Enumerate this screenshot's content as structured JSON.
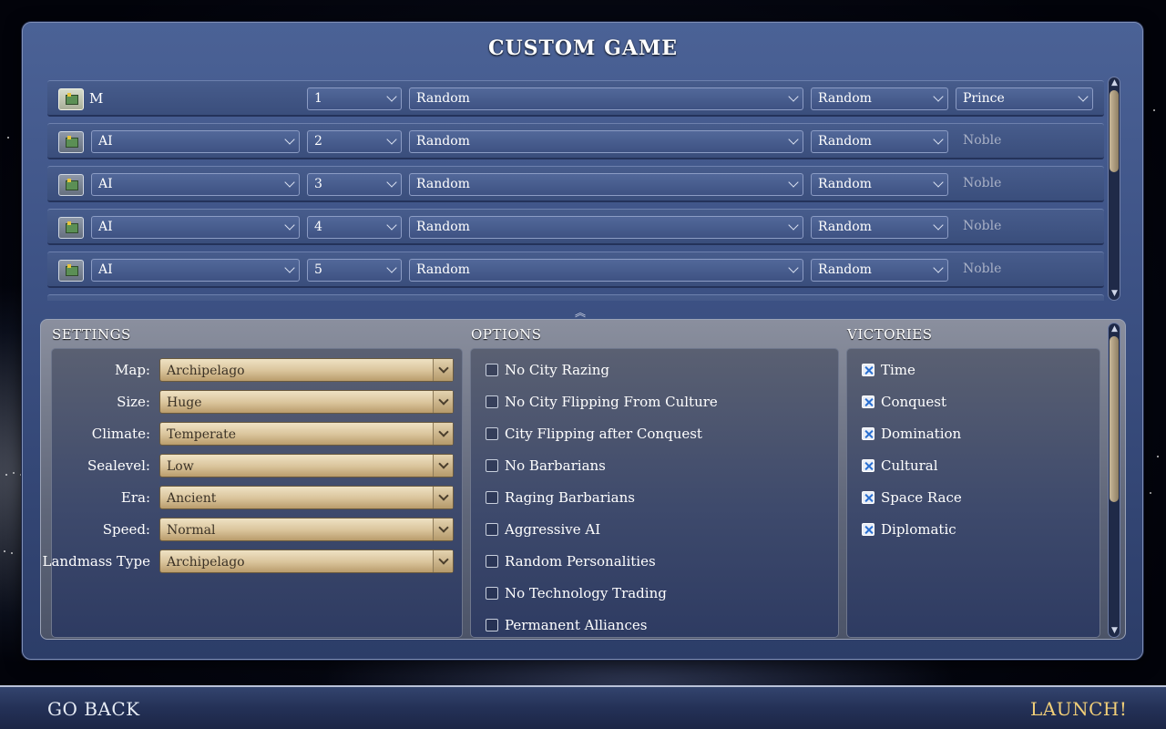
{
  "title": "CUSTOM GAME",
  "players": [
    {
      "type": "M",
      "team": "1",
      "civ": "Random",
      "leader": "Random",
      "level": "Prince",
      "level_is_dropdown": true
    },
    {
      "type": "AI",
      "team": "2",
      "civ": "Random",
      "leader": "Random",
      "level": "Noble"
    },
    {
      "type": "AI",
      "team": "3",
      "civ": "Random",
      "leader": "Random",
      "level": "Noble"
    },
    {
      "type": "AI",
      "team": "4",
      "civ": "Random",
      "leader": "Random",
      "level": "Noble"
    },
    {
      "type": "AI",
      "team": "5",
      "civ": "Random",
      "leader": "Random",
      "level": "Noble"
    }
  ],
  "settings": {
    "heading": "SETTINGS",
    "items": [
      {
        "label": "Map:",
        "value": "Archipelago"
      },
      {
        "label": "Size:",
        "value": "Huge"
      },
      {
        "label": "Climate:",
        "value": "Temperate"
      },
      {
        "label": "Sealevel:",
        "value": "Low"
      },
      {
        "label": "Era:",
        "value": "Ancient"
      },
      {
        "label": "Speed:",
        "value": "Normal"
      },
      {
        "label": "Landmass Type",
        "value": "Archipelago"
      }
    ]
  },
  "options": {
    "heading": "OPTIONS",
    "items": [
      {
        "label": "No City Razing",
        "checked": false
      },
      {
        "label": "No City Flipping From Culture",
        "checked": false
      },
      {
        "label": "City Flipping after Conquest",
        "checked": false
      },
      {
        "label": "No Barbarians",
        "checked": false
      },
      {
        "label": "Raging Barbarians",
        "checked": false
      },
      {
        "label": "Aggressive AI",
        "checked": false
      },
      {
        "label": "Random Personalities",
        "checked": false
      },
      {
        "label": "No Technology Trading",
        "checked": false
      },
      {
        "label": "Permanent Alliances",
        "checked": false
      }
    ]
  },
  "victories": {
    "heading": "VICTORIES",
    "items": [
      {
        "label": "Time",
        "checked": true
      },
      {
        "label": "Conquest",
        "checked": true
      },
      {
        "label": "Domination",
        "checked": true
      },
      {
        "label": "Cultural",
        "checked": true
      },
      {
        "label": "Space Race",
        "checked": true
      },
      {
        "label": "Diplomatic",
        "checked": true
      }
    ]
  },
  "icons": {
    "dropdown": "chevron-down-icon",
    "flag": "flag-icon",
    "collapse": "chevron-double-up-icon",
    "checkbox_checked": "checkbox-checked-icon"
  },
  "colors": {
    "panel": "#3d5285",
    "launch": "#f2cf78",
    "parchment": "#d9c39a"
  },
  "footer": {
    "back_label": "GO BACK",
    "launch_label": "LAUNCH!"
  }
}
